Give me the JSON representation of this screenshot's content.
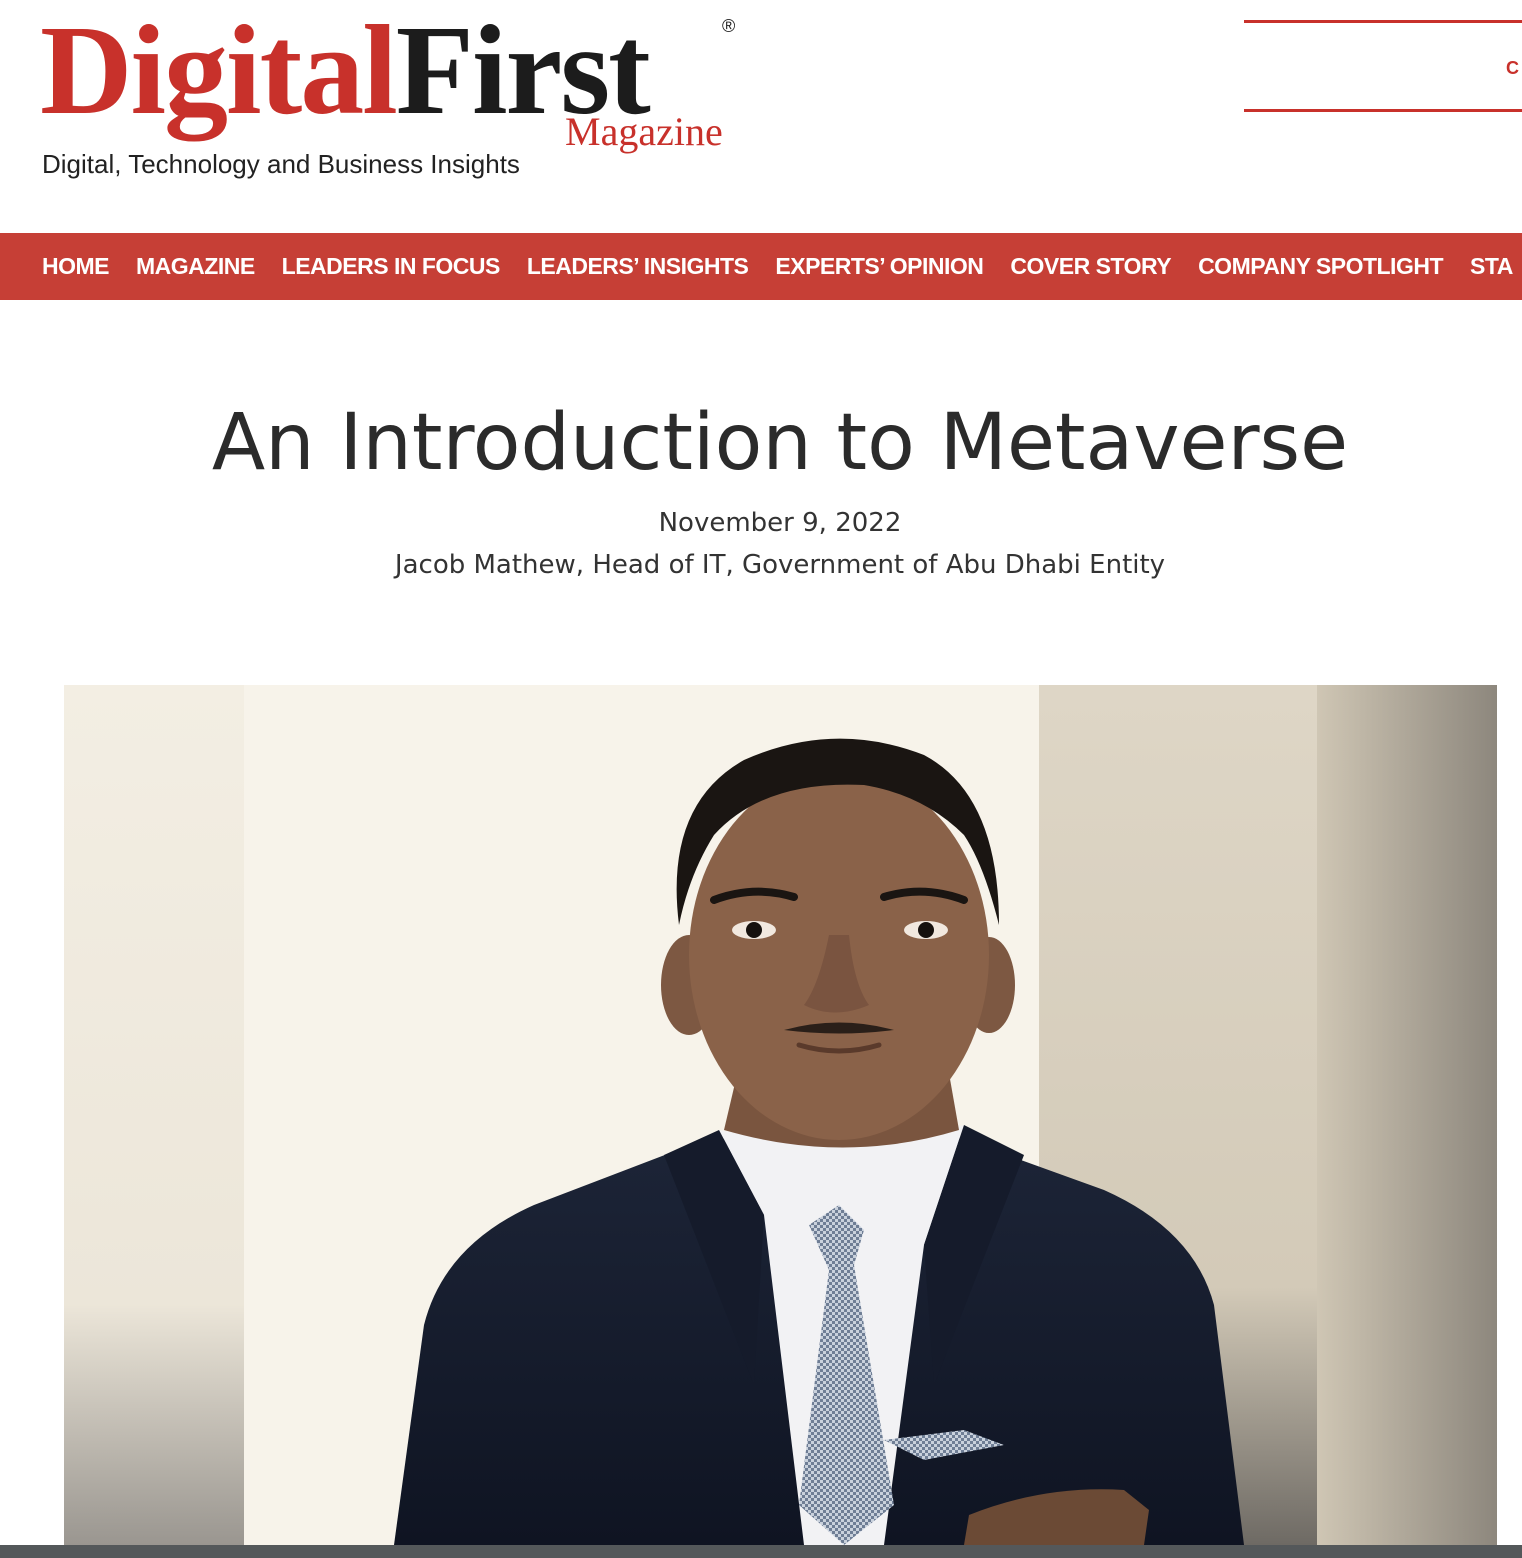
{
  "brand": {
    "word1": "Digital",
    "word2": "First",
    "registered": "®",
    "sub": "Magazine",
    "tagline": "Digital, Technology and Business Insights",
    "colors": {
      "primary_red": "#c8312b",
      "nav_red": "#c63f36",
      "dark": "#1c1c1c"
    }
  },
  "header_widget": {
    "text": "C"
  },
  "nav": {
    "items": [
      {
        "label": "HOME"
      },
      {
        "label": "MAGAZINE"
      },
      {
        "label": "LEADERS IN FOCUS"
      },
      {
        "label": "LEADERS’ INSIGHTS"
      },
      {
        "label": "EXPERTS’ OPINION"
      },
      {
        "label": "COVER STORY"
      },
      {
        "label": "COMPANY SPOTLIGHT"
      },
      {
        "label": "STA"
      }
    ]
  },
  "article": {
    "title": "An Introduction to Metaverse",
    "date": "November 9, 2022",
    "author": "Jacob Mathew, Head of IT, Government of Abu Dhabi Entity"
  }
}
